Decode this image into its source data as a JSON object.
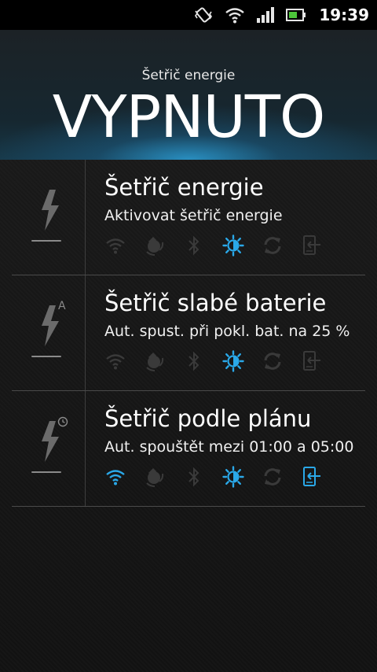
{
  "status_bar": {
    "time": "19:39",
    "icons": [
      "vibrate-icon",
      "wifi-icon",
      "signal-icon",
      "battery-icon"
    ]
  },
  "header": {
    "subtitle": "Šetřič energie",
    "state": "VYPNUTO"
  },
  "colors": {
    "accent_active": "#2aa8e8",
    "inactive_icon": "#3a3a3a",
    "header_glow": "#2c9ed6"
  },
  "modes": [
    {
      "title": "Šetřič energie",
      "description": "Aktivovat šetřič energie",
      "badge": "",
      "features": [
        {
          "icon": "wifi-icon",
          "active": false
        },
        {
          "icon": "data-sync-icon",
          "active": false
        },
        {
          "icon": "bluetooth-icon",
          "active": false
        },
        {
          "icon": "brightness-icon",
          "active": true
        },
        {
          "icon": "sync-icon",
          "active": false
        },
        {
          "icon": "screen-timeout-icon",
          "active": false
        }
      ]
    },
    {
      "title": "Šetřič slabé baterie",
      "description": "Aut. spust. při pokl. bat. na 25 %",
      "badge": "A",
      "features": [
        {
          "icon": "wifi-icon",
          "active": false
        },
        {
          "icon": "data-sync-icon",
          "active": false
        },
        {
          "icon": "bluetooth-icon",
          "active": false
        },
        {
          "icon": "brightness-icon",
          "active": true
        },
        {
          "icon": "sync-icon",
          "active": false
        },
        {
          "icon": "screen-timeout-icon",
          "active": false
        }
      ]
    },
    {
      "title": "Šetřič podle plánu",
      "description": "Aut. spouštět mezi 01:00 a 05:00",
      "badge": "clock",
      "features": [
        {
          "icon": "wifi-icon",
          "active": true
        },
        {
          "icon": "data-sync-icon",
          "active": false
        },
        {
          "icon": "bluetooth-icon",
          "active": false
        },
        {
          "icon": "brightness-icon",
          "active": true
        },
        {
          "icon": "sync-icon",
          "active": false
        },
        {
          "icon": "screen-timeout-icon",
          "active": true
        }
      ]
    }
  ]
}
